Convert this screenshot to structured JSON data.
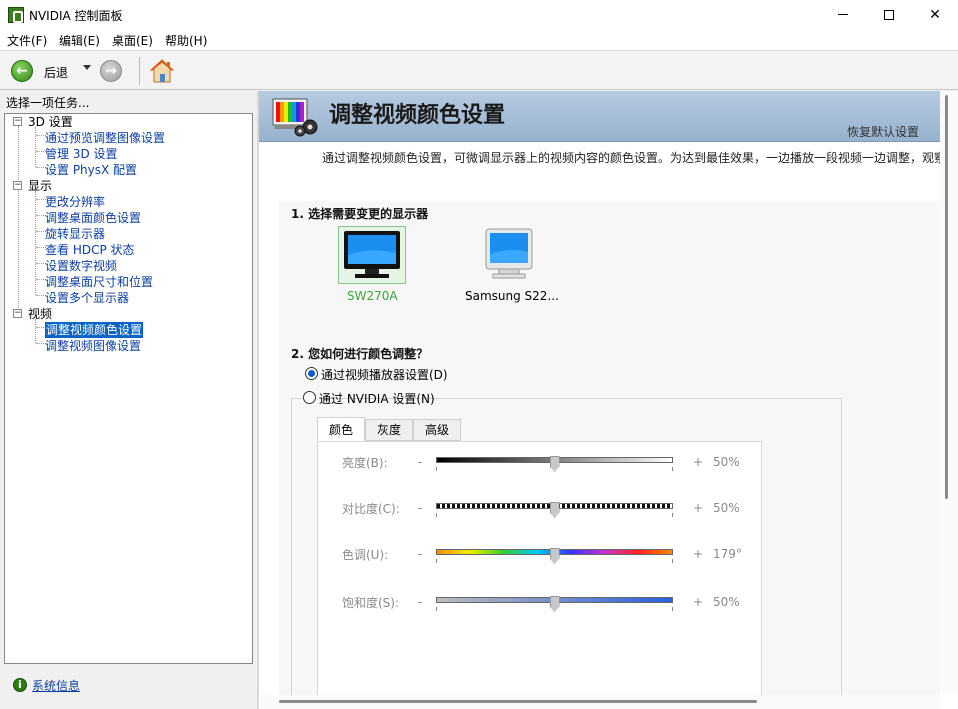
{
  "window": {
    "title": "NVIDIA 控制面板"
  },
  "menu": [
    "文件(F)",
    "编辑(E)",
    "桌面(E)",
    "帮助(H)"
  ],
  "toolbar": {
    "back_label": "后退"
  },
  "left": {
    "header": "选择一项任务...",
    "tree": [
      {
        "label": "3D 设置",
        "children": [
          "通过预览调整图像设置",
          "管理 3D 设置",
          "设置 PhysX 配置"
        ]
      },
      {
        "label": "显示",
        "children": [
          "更改分辨率",
          "调整桌面颜色设置",
          "旋转显示器",
          "查看 HDCP 状态",
          "设置数字视频",
          "调整桌面尺寸和位置",
          "设置多个显示器"
        ]
      },
      {
        "label": "视频",
        "children": [
          "调整视频颜色设置",
          "调整视频图像设置"
        ]
      }
    ],
    "system_info": "系统信息"
  },
  "page": {
    "title": "调整视频颜色设置",
    "restore_default": "恢复默认设置",
    "description": "通过调整视频颜色设置，可微调显示器上的视频内容的颜色设置。为达到最佳效果，一边播放一段视频一边调整，观察",
    "step1": "1. 选择需要变更的显示器",
    "displays": [
      {
        "name": "SW270A",
        "selected": true
      },
      {
        "name": "Samsung S22...",
        "selected": false
      }
    ],
    "step2": "2. 您如何进行颜色调整？",
    "radio_options": [
      {
        "label": "通过视频播放器设置(D)",
        "checked": true
      },
      {
        "label": "通过 NVIDIA 设置(N)",
        "checked": false
      }
    ],
    "tabs": [
      "颜色",
      "灰度",
      "高级"
    ],
    "sliders": [
      {
        "label": "亮度(B):",
        "minus": "-",
        "plus": "+",
        "value": "50%",
        "level": 0.5
      },
      {
        "label": "对比度(C):",
        "minus": "-",
        "plus": "+",
        "value": "50%",
        "level": 0.5
      },
      {
        "label": "色调(U):",
        "minus": "-",
        "plus": "+",
        "value": "179°",
        "level": 0.5
      },
      {
        "label": "饱和度(S):",
        "minus": "-",
        "plus": "+",
        "value": "50%",
        "level": 0.5
      }
    ]
  },
  "colors": {
    "selection": "#0a64c8",
    "link": "#0b3fa3",
    "nvidia_green": "#76b900",
    "banner": "#a9bfd8"
  }
}
